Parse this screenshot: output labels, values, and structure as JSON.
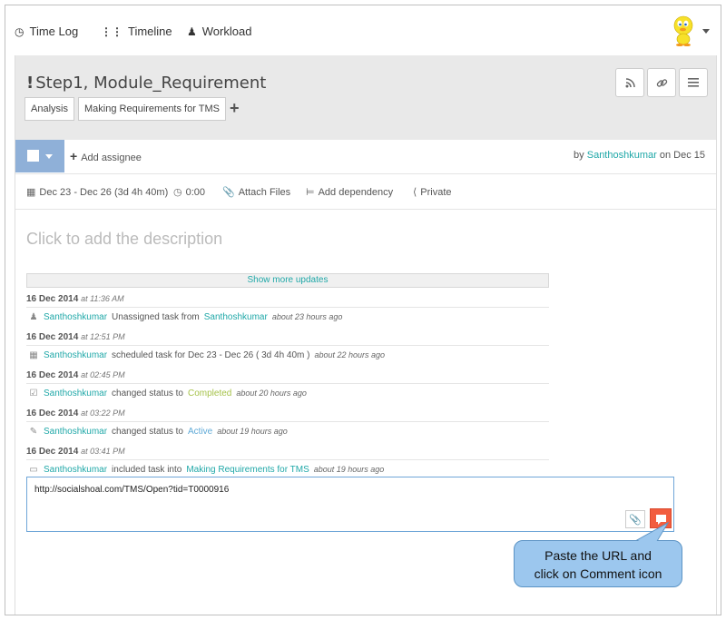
{
  "nav": {
    "items": [
      {
        "label": "Time Log",
        "icon": "clock-icon"
      },
      {
        "label": "Timeline",
        "icon": "sliders-icon"
      },
      {
        "label": "Workload",
        "icon": "user-icon"
      }
    ]
  },
  "task": {
    "title": "Step1, Module_Requirement",
    "tags": [
      "Analysis",
      "Making Requirements for TMS"
    ],
    "add_assignee": "Add assignee",
    "byline_prefix": "by",
    "author": "Santhoshkumar",
    "byline_suffix": "on Dec 15",
    "meta": {
      "dates": "Dec 23 - Dec 26 (3d 4h 40m)",
      "time": "0:00",
      "attach": "Attach Files",
      "dependency": "Add dependency",
      "privacy": "Private"
    },
    "description_placeholder": "Click to add the description"
  },
  "updates": {
    "show_more": "Show more updates",
    "entries": [
      {
        "date": "16 Dec 2014",
        "time": "at 11:36 AM",
        "icon": "unassign-icon",
        "user": "Santhoshkumar",
        "text": "Unassigned task from",
        "link": "Santhoshkumar",
        "ago": "about 23 hours ago"
      },
      {
        "date": "16 Dec 2014",
        "time": "at 12:51 PM",
        "icon": "calendar-icon",
        "user": "Santhoshkumar",
        "text": "scheduled task for Dec 23 - Dec 26 ( 3d 4h 40m )",
        "ago": "about 22 hours ago"
      },
      {
        "date": "16 Dec 2014",
        "time": "at 02:45 PM",
        "icon": "checkbox-icon",
        "user": "Santhoshkumar",
        "text": "changed status to",
        "status": "Completed",
        "ago": "about 20 hours ago"
      },
      {
        "date": "16 Dec 2014",
        "time": "at 03:22 PM",
        "icon": "edit-icon",
        "user": "Santhoshkumar",
        "text": "changed status to",
        "status": "Active",
        "ago": "about 19 hours ago"
      },
      {
        "date": "16 Dec 2014",
        "time": "at 03:41 PM",
        "icon": "folder-icon",
        "user": "Santhoshkumar",
        "text": "included task into",
        "link": "Making Requirements for TMS",
        "ago": "about 19 hours ago"
      }
    ]
  },
  "comment": {
    "value": "http://socialshoal.com/TMS/Open?tid=T0000916"
  },
  "callout": {
    "line1": "Paste the URL and",
    "line2": "click on Comment icon"
  },
  "colors": {
    "accent": "#20a8a8",
    "comment_button": "#f25d3f",
    "callout": "#9cc7ee",
    "completed": "#a6c24a",
    "active": "#5fa9d6"
  }
}
